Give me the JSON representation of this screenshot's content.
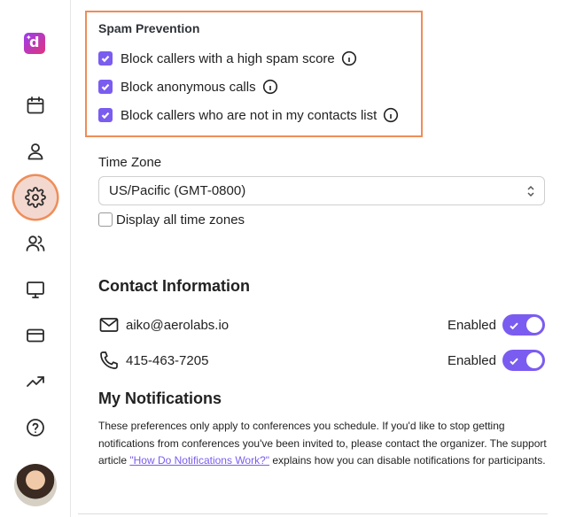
{
  "sidebar": {
    "logo_letter": "d",
    "items": [
      {
        "icon": "calendar-icon"
      },
      {
        "icon": "user-icon"
      },
      {
        "icon": "gear-icon",
        "active": true
      },
      {
        "icon": "users-icon"
      },
      {
        "icon": "monitor-icon"
      },
      {
        "icon": "credit-card-icon"
      },
      {
        "icon": "trending-up-icon"
      },
      {
        "icon": "help-icon"
      }
    ],
    "avatar": "user-avatar"
  },
  "spam": {
    "title": "Spam Prevention",
    "options": [
      {
        "label": "Block callers with a high spam score",
        "checked": true
      },
      {
        "label": "Block anonymous calls",
        "checked": true
      },
      {
        "label": "Block callers who are not in my contacts list",
        "checked": true
      }
    ]
  },
  "timezone": {
    "label": "Time Zone",
    "selected": "US/Pacific (GMT-0800)",
    "show_all_label": "Display all time zones",
    "show_all_checked": false
  },
  "contact": {
    "title": "Contact Information",
    "email": {
      "value": "aiko@aerolabs.io",
      "status": "Enabled",
      "enabled": true
    },
    "phone": {
      "value": "415-463-7205",
      "status": "Enabled",
      "enabled": true
    }
  },
  "notifications": {
    "title": "My Notifications",
    "text_before": "These preferences only apply to conferences you schedule. If you'd like to stop getting notifications from conferences you've been invited to, please contact the organizer. The support article ",
    "link_text": "\"How Do Notifications Work?\"",
    "text_after": " explains how you can disable notifications for participants."
  },
  "colors": {
    "accent": "#7b5cf0",
    "highlight": "#ef8d58"
  }
}
